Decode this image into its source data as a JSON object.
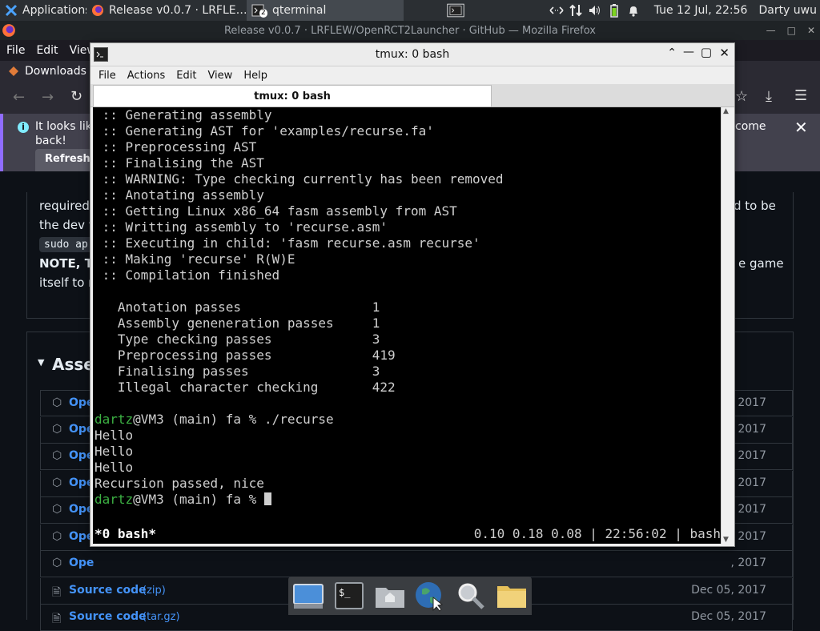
{
  "panel": {
    "applications_label": "Applications",
    "tasks": [
      {
        "label": "Release v0.0.7 · LRFLE…",
        "icon": "firefox-icon"
      },
      {
        "label": "qterminal",
        "icon": "terminal-icon",
        "badge": "2"
      }
    ],
    "datetime": "Tue 12 Jul, 22:56",
    "user": "Darty uwu"
  },
  "firefox": {
    "window_title": "Release v0.0.7 · LRFLEW/OpenRCT2Launcher · GitHub — Mozilla Firefox",
    "menu": [
      "File",
      "Edit",
      "View"
    ],
    "bookmark": "Downloads",
    "notice_text_left": "It looks lik",
    "notice_text_left2": "back!",
    "notice_text_right": "come",
    "refresh_label": "Refresh",
    "body_lines": {
      "line1_left": "required",
      "line1_right": "d to be",
      "line2_left": "the dev v",
      "code_left": "sudo ap",
      "note_left": "NOTE, T",
      "note_right": "e game",
      "line4_left": "itself to r"
    },
    "assets_heading": "Asse",
    "asset_rows": [
      {
        "label": "Ope",
        "date": ", 2017"
      },
      {
        "label": "Ope",
        "date": ", 2017"
      },
      {
        "label": "Ope",
        "date": ", 2017"
      },
      {
        "label": "Ope",
        "date": ", 2017"
      },
      {
        "label": "Ope",
        "date": ", 2017"
      },
      {
        "label": "Ope",
        "date": ", 2017"
      },
      {
        "label": "Ope",
        "date": ", 2017"
      },
      {
        "label": "Source code",
        "ext": "(zip)",
        "date": "Dec 05, 2017"
      },
      {
        "label": "Source code",
        "ext": "(tar.gz)",
        "date": "Dec 05, 2017"
      }
    ]
  },
  "qterminal": {
    "window_title": "tmux: 0 bash",
    "menu": [
      "File",
      "Actions",
      "Edit",
      "View",
      "Help"
    ],
    "tab_label": "tmux: 0 bash",
    "output_lines": [
      " :: Generating assembly",
      " :: Generating AST for 'examples/recurse.fa'",
      " :: Preprocessing AST",
      " :: Finalising the AST",
      " :: WARNING: Type checking currently has been removed",
      " :: Anotating assembly",
      " :: Getting Linux x86_64 fasm assembly from AST",
      " :: Writting assembly to 'recurse.asm'",
      " :: Executing in child: 'fasm recurse.asm recurse'",
      " :: Making 'recurse' R(W)E",
      " :: Compilation finished",
      "",
      "   Anotation passes                 1",
      "   Assembly geneneration passes     1",
      "   Type checking passes             3",
      "   Preprocessing passes             419",
      "   Finalising passes                3",
      "   Illegal character checking       422",
      ""
    ],
    "prompt_user": "dartz",
    "prompt_rest": "@VM3 (main) fa % ",
    "command": "./recurse",
    "program_output": [
      "Hello",
      "Hello",
      "Hello",
      "Recursion passed, nice",
      ""
    ],
    "status_left": " *0 bash*",
    "status_right": "0.10 0.18 0.08 | 22:56:02 | bash "
  },
  "dock": [
    "monitor-icon",
    "terminal-icon",
    "home-folder-icon",
    "web-browser-icon",
    "search-icon",
    "folder-icon"
  ]
}
